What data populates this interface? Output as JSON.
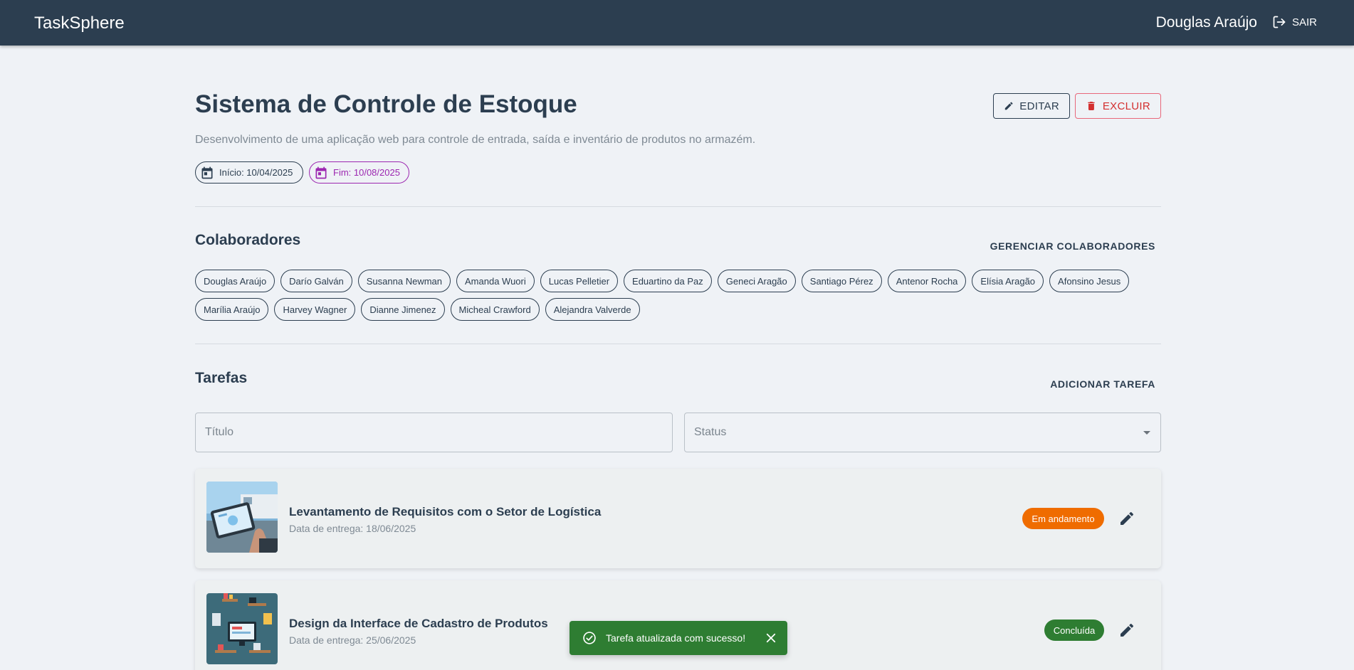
{
  "app": {
    "brand": "TaskSphere",
    "user_name": "Douglas Araújo",
    "logout_label": "SAIR"
  },
  "project": {
    "title": "Sistema de Controle de Estoque",
    "description": "Desenvolvimento de uma aplicação web para controle de entrada, saída e inventário de produtos no armazém.",
    "start_label": "Início: 10/04/2025",
    "end_label": "Fim: 10/08/2025",
    "edit_label": "EDITAR",
    "delete_label": "EXCLUIR"
  },
  "collaborators": {
    "title": "Colaboradores",
    "manage_label": "GERENCIAR COLABORADORES",
    "names": [
      "Douglas Araújo",
      "Darío Galván",
      "Susanna Newman",
      "Amanda Wuori",
      "Lucas Pelletier",
      "Eduartino da Paz",
      "Geneci Aragão",
      "Santiago Pérez",
      "Antenor Rocha",
      "Elísia Aragão",
      "Afonsino Jesus",
      "Marília Araújo",
      "Harvey Wagner",
      "Dianne Jimenez",
      "Micheal Crawford",
      "Alejandra Valverde"
    ]
  },
  "tasks": {
    "title": "Tarefas",
    "add_label": "ADICIONAR TAREFA",
    "filter_title_placeholder": "Título",
    "filter_status_placeholder": "Status",
    "items": [
      {
        "name": "Levantamento de Requisitos com o Setor de Logística",
        "due": "Data de entrega: 18/06/2025",
        "status": "Em andamento",
        "status_color": "#ef6c00"
      },
      {
        "name": "Design da Interface de Cadastro de Produtos",
        "due": "Data de entrega: 25/06/2025",
        "status": "Concluída",
        "status_color": "#2e7d32"
      }
    ]
  },
  "toast": {
    "message": "Tarefa atualizada com sucesso!"
  },
  "colors": {
    "primary": "#2c3e50",
    "danger": "#d32f2f",
    "purple": "#9c27b0",
    "success": "#2e7d32",
    "warning": "#ef6c00"
  }
}
